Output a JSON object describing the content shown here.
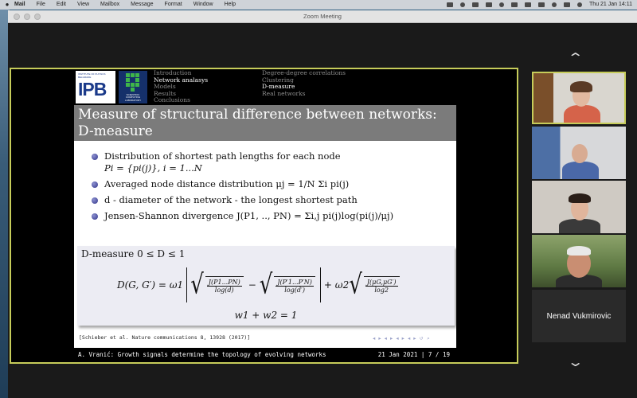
{
  "menubar": {
    "app": "Mail",
    "items": [
      "File",
      "Edit",
      "View",
      "Mailbox",
      "Message",
      "Format",
      "Window",
      "Help"
    ],
    "clock": "Thu 21 Jan  14:11"
  },
  "window": {
    "title": "Zoom Meeting"
  },
  "slide": {
    "logo_ipb_small": "INSTITUTE OF PHYSICS BELGRADE",
    "logo_ipb_mark": "IPB",
    "logo_scl_text": "SCIENTIFIC COMPUTING LABORATORY",
    "nav_left": [
      "Introduction",
      "Network analasys",
      "Models",
      "Results",
      "Conclusions"
    ],
    "nav_right": [
      "Degree-degree correlations",
      "Clustering",
      "D-measure",
      "Real networks"
    ],
    "title": "Measure of structural difference between networks: D-measure",
    "bullets": {
      "b1_line1": "Distribution of shortest path lengths for each node",
      "b1_line2": "Pi = {pi(j)}, i = 1...N",
      "b2": "Averaged node distance distribution μj = 1/N Σi pi(j)",
      "b3": "d - diameter of the network - the longest shortest path",
      "b4": "Jensen-Shannon divergence J(P1, .., PN) = Σi,j pi(j)log(pi(j)/μj)"
    },
    "block": {
      "head": "D-measure 0 ≤ D ≤ 1",
      "lhs": "D(G, G′) = ω1",
      "f1_num": "J(P1...PN)",
      "f1_den": "log(d)",
      "minus": "−",
      "f2_num": "J(P′1...P′N)",
      "f2_den": "log(d′)",
      "plus_w2": "+ ω2",
      "f3_num": "J(μG,μG′)",
      "f3_den": "log2",
      "eq2": "w1 + w2 = 1"
    },
    "citation": "[Schieber et al. Nature communications 8, 13928 (2017)]",
    "footer_left": "A. Vranić: Growth signals determine the topology of evolving networks",
    "footer_right": "21 Jan 2021  |  7 / 19"
  },
  "participants": {
    "name_tile": "Nenad Vukmirovic"
  }
}
